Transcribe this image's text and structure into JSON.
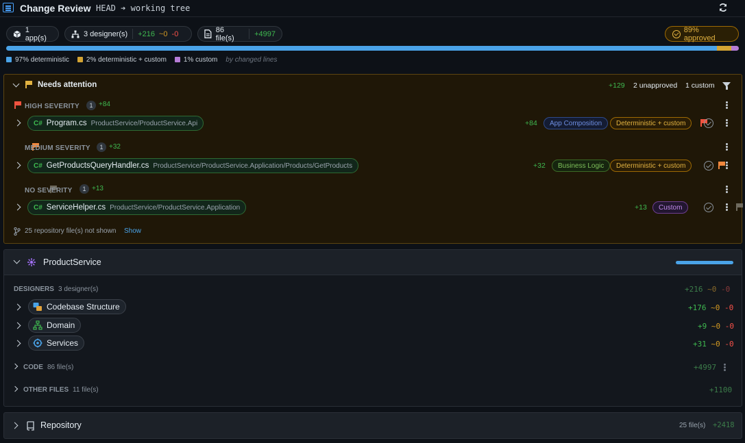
{
  "header": {
    "title": "Change Review",
    "ref_from": "HEAD",
    "arrow": "➔",
    "ref_to": "working tree"
  },
  "summary": {
    "apps": "1 app(s)",
    "designers": "3 designer(s)",
    "designers_add": "+216",
    "designers_mod": "~0",
    "designers_del": "-0",
    "files": "86 file(s)",
    "files_add": "+4997",
    "approved": "89% approved",
    "progress": [
      {
        "label": "97% deterministic",
        "fraction": 0.97,
        "color": "#4aa3e8"
      },
      {
        "label": "2% deterministic + custom",
        "fraction": 0.02,
        "color": "#d4a434"
      },
      {
        "label": "1% custom",
        "fraction": 0.01,
        "color": "#b57cd6"
      }
    ],
    "by_note": "by changed lines"
  },
  "attention": {
    "title": "Needs attention",
    "add": "+129",
    "unapproved": "2 unapproved",
    "custom": "1 custom",
    "groups": [
      {
        "severity": "HIGH SEVERITY",
        "count": "1",
        "add": "+84",
        "flag_color": "#f0533f",
        "file": {
          "lang": "C#",
          "name": "Program.cs",
          "path": "ProductService/ProductService.Api",
          "add": "+84",
          "category": "App Composition",
          "kind": "Deterministic + custom"
        }
      },
      {
        "severity": "MEDIUM SEVERITY",
        "count": "1",
        "add": "+32",
        "flag_color": "#f0883e",
        "file": {
          "lang": "C#",
          "name": "GetProductsQueryHandler.cs",
          "path": "ProductService/ProductService.Application/Products/GetProducts",
          "add": "+32",
          "category": "Business Logic",
          "kind": "Deterministic + custom"
        }
      },
      {
        "severity": "NO SEVERITY",
        "count": "1",
        "add": "+13",
        "flag_color": "#6e6a5e",
        "file": {
          "lang": "C#",
          "name": "ServiceHelper.cs",
          "path": "ProductService/ProductService.Application",
          "add": "+13",
          "category": "",
          "kind": "Custom"
        }
      }
    ],
    "hidden_note": "25 repository file(s) not shown",
    "show_label": "Show"
  },
  "product_service": {
    "title": "ProductService",
    "designers_label": "DESIGNERS",
    "designers_count": "3 designer(s)",
    "designers_add": "+216",
    "designers_mod": "~0",
    "designers_del": "-0",
    "designers": [
      {
        "name": "Codebase Structure",
        "add": "+176",
        "mod": "~0",
        "del": "-0",
        "icon": "codebase-structure-icon"
      },
      {
        "name": "Domain",
        "add": "+9",
        "mod": "~0",
        "del": "-0",
        "icon": "domain-icon"
      },
      {
        "name": "Services",
        "add": "+31",
        "mod": "~0",
        "del": "-0",
        "icon": "services-icon"
      }
    ],
    "code_label": "CODE",
    "code_count": "86 file(s)",
    "code_add": "+4997",
    "other_label": "OTHER FILES",
    "other_count": "11 file(s)",
    "other_add": "+1100"
  },
  "repository": {
    "title": "Repository",
    "count": "25 file(s)",
    "add": "+2418"
  }
}
